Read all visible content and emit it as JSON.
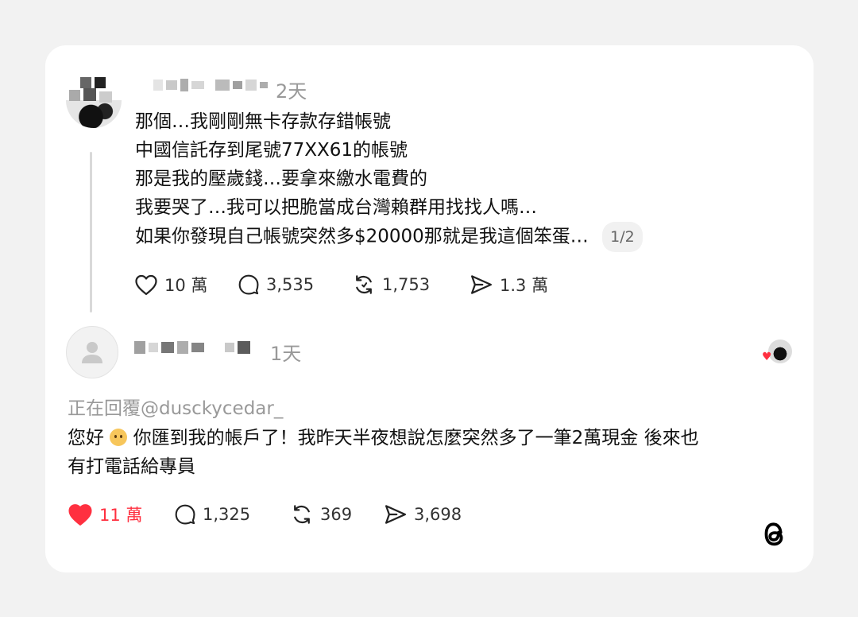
{
  "post": {
    "time": "2天",
    "lines": [
      "那個…我剛剛無卡存款存錯帳號",
      "中國信託存到尾號77XX61的帳號",
      "那是我的壓歲錢…要拿來繳水電費的",
      "我要哭了…我可以把脆當成台灣賴群用找找人嗎…",
      "如果你發現自己帳號突然多$20000那就是我這個笨蛋…"
    ],
    "page_indicator": "1/2",
    "likes": "10 萬",
    "comments": "3,535",
    "reposts": "1,753",
    "shares": "1.3 萬"
  },
  "reply": {
    "time": "1天",
    "replying_to": "正在回覆@dusckycedar_",
    "lines": [
      "您好",
      "你匯到我的帳戶了！我昨天半夜想說怎麼突然多了一筆2萬現金 後來也",
      "有打電話給專員"
    ],
    "likes": "11 萬",
    "comments": "1,325",
    "reposts": "369",
    "shares": "3,698",
    "liked": true
  },
  "colors": {
    "like_red": "#ff3040",
    "muted_gray": "#999999"
  },
  "icons": [
    "heart-icon",
    "comment-icon",
    "repost-icon",
    "share-icon",
    "threads-logo"
  ]
}
